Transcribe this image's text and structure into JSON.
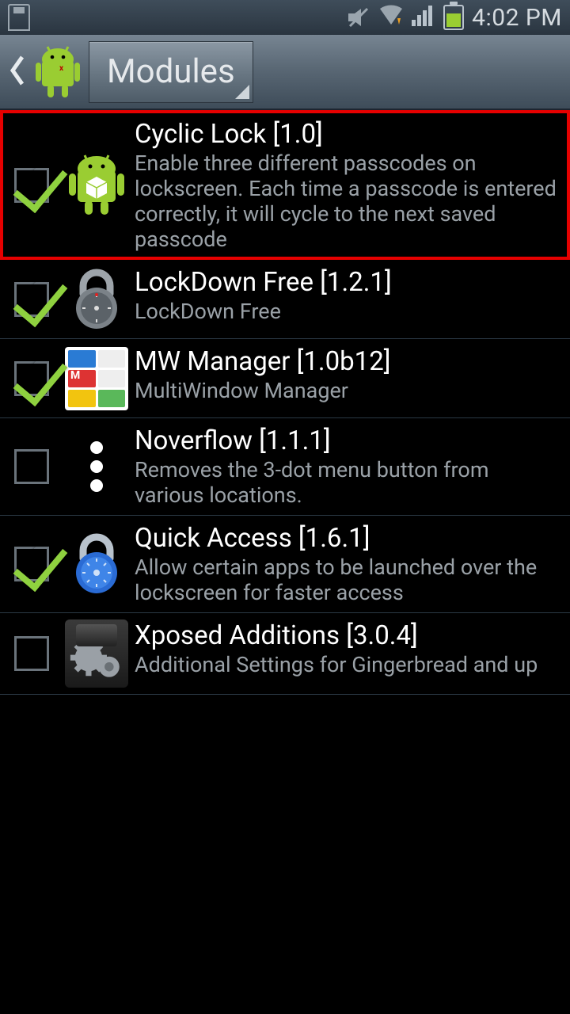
{
  "statusbar": {
    "time": "4:02 PM"
  },
  "header": {
    "dropdown_label": "Modules"
  },
  "modules": [
    {
      "title": "Cyclic Lock [1.0]",
      "desc": "Enable three different passcodes on lockscreen. Each time a passcode is entered correctly, it will cycle to the next saved passcode",
      "checked": true,
      "highlighted": true,
      "icon": "android-cube"
    },
    {
      "title": "LockDown Free [1.2.1]",
      "desc": "LockDown Free",
      "checked": true,
      "highlighted": false,
      "icon": "padlock-grey"
    },
    {
      "title": "MW Manager [1.0b12]",
      "desc": "MultiWindow Manager",
      "checked": true,
      "highlighted": false,
      "icon": "mw-grid"
    },
    {
      "title": "Noverflow [1.1.1]",
      "desc": "Removes the 3-dot menu button from various locations.",
      "checked": false,
      "highlighted": false,
      "icon": "three-dots"
    },
    {
      "title": "Quick Access [1.6.1]",
      "desc": "Allow certain apps to be launched over the lockscreen for faster access",
      "checked": true,
      "highlighted": false,
      "icon": "padlock-blue"
    },
    {
      "title": "Xposed Additions [3.0.4]",
      "desc": "Additional Settings for Gingerbread and up",
      "checked": false,
      "highlighted": false,
      "icon": "phone-gears"
    }
  ]
}
